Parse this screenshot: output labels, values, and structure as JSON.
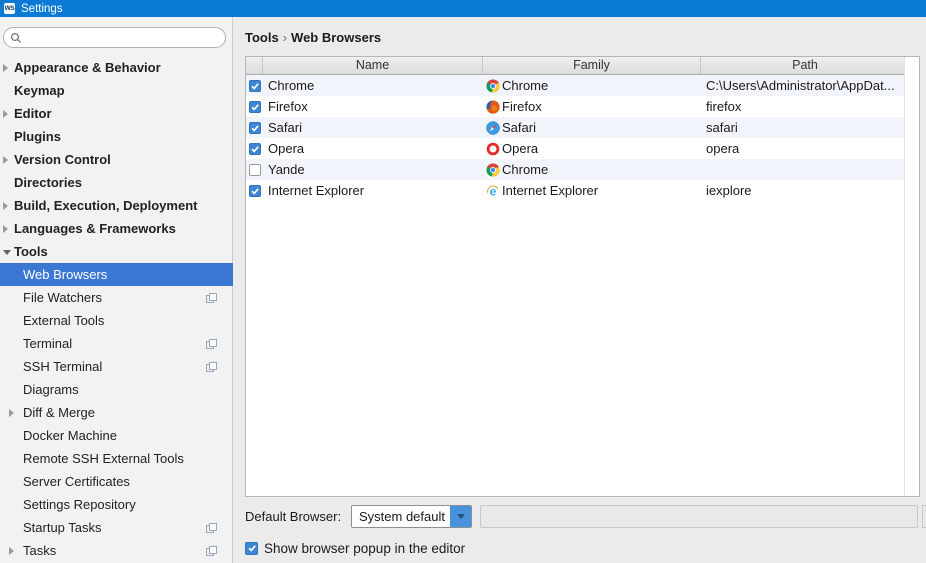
{
  "titlebar": {
    "app_badge": "WS",
    "title": "Settings"
  },
  "search": {
    "placeholder": "",
    "value": ""
  },
  "sidebar": {
    "items": [
      {
        "label": "Appearance & Behavior",
        "level": 0,
        "arrow": "right"
      },
      {
        "label": "Keymap",
        "level": 0
      },
      {
        "label": "Editor",
        "level": 0,
        "arrow": "right"
      },
      {
        "label": "Plugins",
        "level": 0
      },
      {
        "label": "Version Control",
        "level": 0,
        "arrow": "right"
      },
      {
        "label": "Directories",
        "level": 0
      },
      {
        "label": "Build, Execution, Deployment",
        "level": 0,
        "arrow": "right"
      },
      {
        "label": "Languages & Frameworks",
        "level": 0,
        "arrow": "right"
      },
      {
        "label": "Tools",
        "level": 0,
        "arrow": "down"
      },
      {
        "label": "Web Browsers",
        "level": 1,
        "selected": true
      },
      {
        "label": "File Watchers",
        "level": 1,
        "badge": true
      },
      {
        "label": "External Tools",
        "level": 1
      },
      {
        "label": "Terminal",
        "level": 1,
        "badge": true
      },
      {
        "label": "SSH Terminal",
        "level": 1,
        "badge": true
      },
      {
        "label": "Diagrams",
        "level": 1
      },
      {
        "label": "Diff & Merge",
        "level": 1,
        "arrow": "right"
      },
      {
        "label": "Docker Machine",
        "level": 1
      },
      {
        "label": "Remote SSH External Tools",
        "level": 1
      },
      {
        "label": "Server Certificates",
        "level": 1
      },
      {
        "label": "Settings Repository",
        "level": 1
      },
      {
        "label": "Startup Tasks",
        "level": 1,
        "badge": true
      },
      {
        "label": "Tasks",
        "level": 1,
        "arrow": "right",
        "badge": true
      }
    ]
  },
  "breadcrumb": {
    "parts": [
      "Tools",
      "Web Browsers"
    ],
    "separator": "›"
  },
  "table": {
    "columns": [
      "",
      "Name",
      "Family",
      "Path"
    ],
    "rows": [
      {
        "checked": true,
        "name": "Chrome",
        "family": "Chrome",
        "icon": "chrome",
        "path": "C:\\Users\\Administrator\\AppDat..."
      },
      {
        "checked": true,
        "name": "Firefox",
        "family": "Firefox",
        "icon": "firefox",
        "path": "firefox"
      },
      {
        "checked": true,
        "name": "Safari",
        "family": "Safari",
        "icon": "safari",
        "path": "safari"
      },
      {
        "checked": true,
        "name": "Opera",
        "family": "Opera",
        "icon": "opera",
        "path": "opera"
      },
      {
        "checked": false,
        "name": "Yande",
        "family": "Chrome",
        "icon": "chrome",
        "path": ""
      },
      {
        "checked": true,
        "name": "Internet Explorer",
        "family": "Internet Explorer",
        "icon": "ie",
        "path": "iexplore"
      }
    ]
  },
  "footer": {
    "default_browser_label": "Default Browser:",
    "default_browser_value": "System default",
    "show_popup_label": "Show browser popup in the editor",
    "show_popup_checked": true
  },
  "colors": {
    "titlebar": "#0a7ad4",
    "selection": "#3b77d3",
    "row_stripe": "#f1f4fa",
    "checkbox": "#3f86d2",
    "combo_button": "#4b92dc"
  }
}
